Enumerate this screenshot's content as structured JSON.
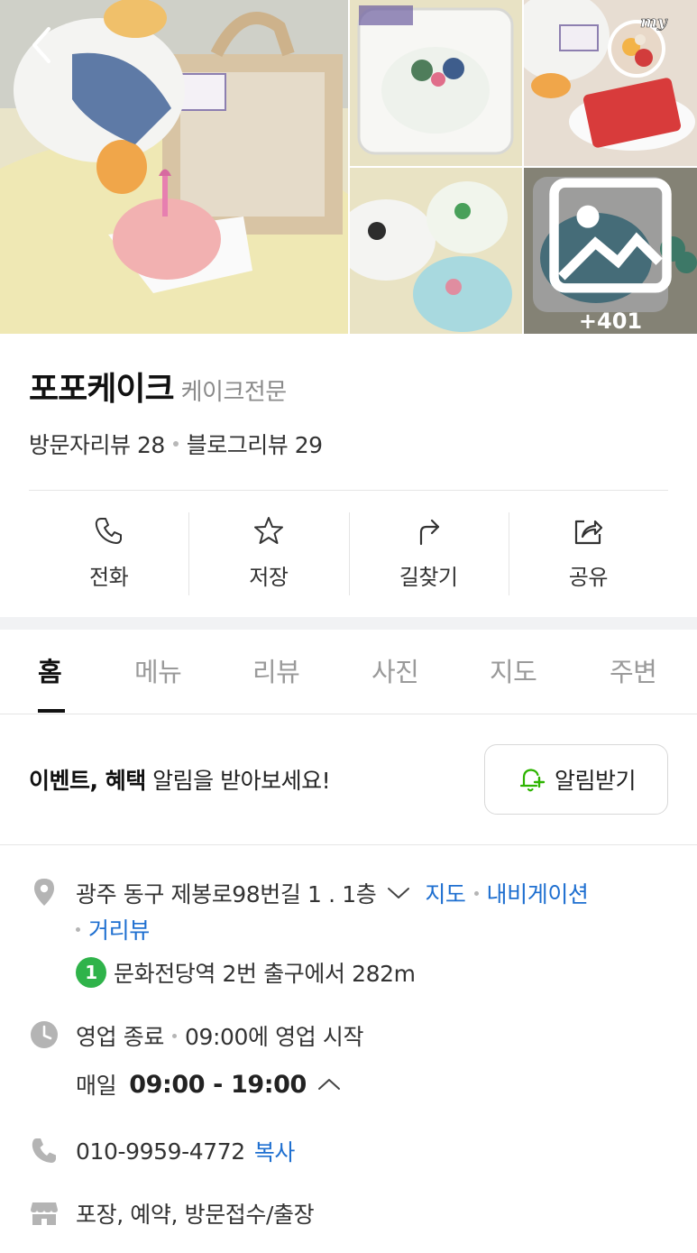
{
  "gallery": {
    "more_count": "+401",
    "my_badge": "my"
  },
  "store": {
    "name": "포포케이크",
    "category": "케이크전문",
    "visitor_reviews": "방문자리뷰 28",
    "blog_reviews": "블로그리뷰 29"
  },
  "actions": [
    {
      "label": "전화",
      "icon": "phone-icon"
    },
    {
      "label": "저장",
      "icon": "star-icon"
    },
    {
      "label": "길찾기",
      "icon": "directions-icon"
    },
    {
      "label": "공유",
      "icon": "share-icon"
    }
  ],
  "tabs": [
    {
      "label": "홈",
      "active": true
    },
    {
      "label": "메뉴"
    },
    {
      "label": "리뷰"
    },
    {
      "label": "사진"
    },
    {
      "label": "지도"
    },
    {
      "label": "주변"
    }
  ],
  "notice": {
    "bold": "이벤트, 혜택",
    "rest": " 알림을 받아보세요!",
    "button": "알림받기"
  },
  "info": {
    "address": "광주 동구 제봉로98번길 1 . 1층",
    "map_link": "지도",
    "navigation_link": "내비게이션",
    "street_view_link": "거리뷰",
    "subway_line": "1",
    "subway_text": "문화전당역 2번 출구에서 282m",
    "status": "영업 종료",
    "next_open": "09:00에 영업 시작",
    "hours_day": "매일",
    "hours_time": "09:00 - 19:00",
    "phone": "010-9959-4772",
    "copy_link": "복사",
    "services": "포장, 예약, 방문접수/출장"
  },
  "colors": {
    "link": "#1e6fd0",
    "subway_line_1": "#2fb34a",
    "notify_bell": "#2db400"
  }
}
